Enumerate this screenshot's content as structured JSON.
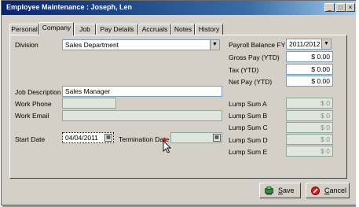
{
  "window": {
    "title": "Employee Maintenance : Joseph, Len"
  },
  "titlebar_buttons": {
    "minimize": "_",
    "maximize": "□",
    "close": "×"
  },
  "tabs": [
    {
      "label": "Personal",
      "active": false
    },
    {
      "label": "Company",
      "active": true
    },
    {
      "label": "Job",
      "active": false
    },
    {
      "label": "Pay Details",
      "active": false
    },
    {
      "label": "Accruals",
      "active": false
    },
    {
      "label": "Notes",
      "active": false
    },
    {
      "label": "History",
      "active": false
    }
  ],
  "form": {
    "division_label": "Division",
    "division_value": "Sales Department",
    "job_description_label": "Job Description",
    "job_description_value": "Sales Manager",
    "work_phone_label": "Work Phone",
    "work_phone_value": "",
    "work_email_label": "Work Email",
    "work_email_value": "",
    "start_date_label": "Start Date",
    "start_date_value": "04/04/2011",
    "termination_date_label": "Termination Date",
    "termination_date_value": ""
  },
  "payroll": {
    "balance_fy_label": "Payroll Balance FY",
    "balance_fy_value": "2011/2012",
    "gross_pay_label": "Gross Pay (YTD)",
    "gross_pay_value": "$ 0.00",
    "tax_label": "Tax (YTD)",
    "tax_value": "$ 0.00",
    "net_pay_label": "Net Pay (YTD)",
    "net_pay_value": "$ 0.00"
  },
  "lump_sums": [
    {
      "label": "Lump Sum A",
      "value": "$ 0"
    },
    {
      "label": "Lump Sum B",
      "value": "$ 0"
    },
    {
      "label": "Lump Sum C",
      "value": "$ 0"
    },
    {
      "label": "Lump Sum D",
      "value": "$ 0"
    },
    {
      "label": "Lump Sum E",
      "value": "$ 0"
    }
  ],
  "buttons": {
    "save_label": "Save",
    "save_underline": "S",
    "save_rest": "ave",
    "cancel_label": "Cancel",
    "cancel_underline": "C",
    "cancel_rest": "ancel"
  },
  "icons": {
    "save": "save-icon",
    "cancel": "cancel-icon",
    "calendar": "calendar-icon",
    "dropdown": "chevron-down-icon",
    "cursor": "mouse-pointer-icon"
  },
  "colors": {
    "title_bar": "#0a246a",
    "face": "#d4d0c8",
    "field_border": "#7f9db9",
    "save_icon": "#2e8b3c",
    "cancel_icon": "#d02020"
  }
}
